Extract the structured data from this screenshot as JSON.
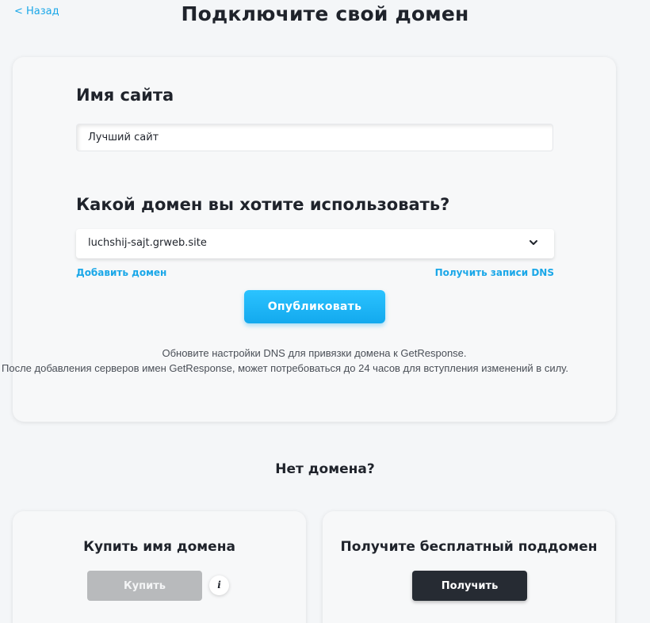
{
  "nav": {
    "back_label": "< Назад"
  },
  "header": {
    "title": "Подключите свой домен"
  },
  "form": {
    "site_name_label": "Имя сайта",
    "site_name_value": "Лучший сайт",
    "domain_question": "Какой домен вы хотите использовать?",
    "domain_selected": "luchshij-sajt.grweb.site",
    "add_domain_link": "Добавить домен",
    "dns_records_link": "Получить записи DNS",
    "publish_button": "Опубликовать",
    "note_line_1": "Обновите настройки DNS для привязки домена к GetResponse.",
    "note_line_2": "После добавления серверов имен GetResponse, может потребоваться до 24 часов для вступления изменений в силу."
  },
  "no_domain": {
    "title": "Нет домена?",
    "buy_card": {
      "title": "Купить имя домена",
      "button": "Купить",
      "info_icon": "i"
    },
    "free_card": {
      "title": "Получите бесплатный поддомен",
      "button": "Получить"
    }
  },
  "colors": {
    "accent": "#1aa7e8",
    "primary_button": "#13a9ee",
    "dark_button": "#262b33",
    "disabled_button": "#b8babc"
  }
}
